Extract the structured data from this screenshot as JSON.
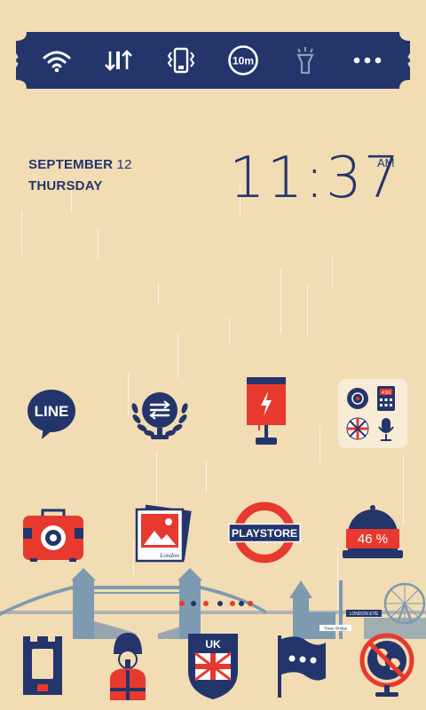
{
  "quick_settings": {
    "items": [
      {
        "icon": "wifi-icon"
      },
      {
        "icon": "data-transfer-icon"
      },
      {
        "icon": "vibrate-icon"
      },
      {
        "icon": "screen-timeout-icon",
        "label": "10m"
      },
      {
        "icon": "flashlight-icon"
      },
      {
        "icon": "more-icon"
      }
    ]
  },
  "date": {
    "month": "SEPTEMBER",
    "day": "12",
    "weekday": "THURSDAY"
  },
  "clock": {
    "time": "11:37",
    "ampm": "AM"
  },
  "apps": {
    "line": {
      "icon": "line-app-icon",
      "label": "LINE"
    },
    "settings": {
      "icon": "settings-laurel-icon"
    },
    "battery_lamp": {
      "icon": "battery-lamp-icon"
    },
    "folder": {
      "icon": "app-folder-icon",
      "mini_label": "4:59"
    },
    "camera": {
      "icon": "camera-suitcase-icon"
    },
    "gallery": {
      "icon": "gallery-icon",
      "caption": "London"
    },
    "playstore": {
      "icon": "playstore-roundel-icon",
      "label": "PLAYSTORE"
    },
    "memory": {
      "icon": "memory-cloche-icon",
      "label": "46 %"
    }
  },
  "skyline": {
    "sign_1": "LONDON EYE",
    "sign_2": "Tower Bridge"
  },
  "dock": {
    "phone": {
      "icon": "phone-tower-icon"
    },
    "contacts": {
      "icon": "guard-contacts-icon"
    },
    "uk": {
      "icon": "uk-shield-icon",
      "label": "UK"
    },
    "messages": {
      "icon": "message-flag-icon"
    },
    "browser": {
      "icon": "globe-browser-icon"
    }
  },
  "colors": {
    "navy": "#23356b",
    "red": "#e8392e",
    "background": "#f2dcb4",
    "slate": "#7e9ab0"
  }
}
